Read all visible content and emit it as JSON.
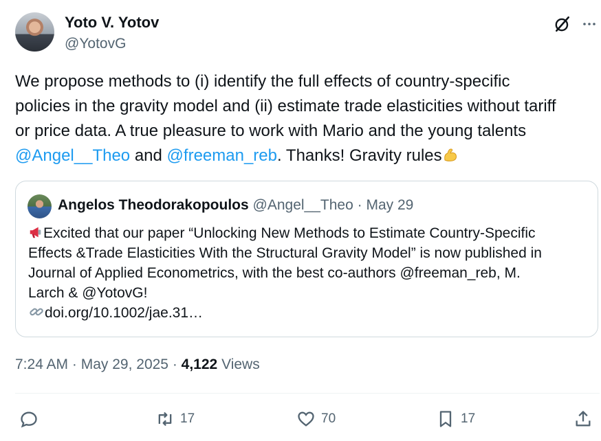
{
  "author": {
    "display_name": "Yoto V. Yotov",
    "handle": "@YotovG"
  },
  "header_icons": [
    "grok-icon",
    "more-icon"
  ],
  "tweet": {
    "line1": "We propose methods to (i) identify the full effects of country-specific",
    "line2": "policies in the gravity model and (ii) estimate trade elasticities without tariff",
    "line3": "or price data. A true pleasure to work with Mario and the young talents",
    "mention1": "@Angel__Theo",
    "and": " and ",
    "mention2": "@freeman_reb",
    "tail": ". Thanks! Gravity rules",
    "emoji": "flexed-biceps-emoji"
  },
  "quote": {
    "name": "Angelos Theodorakopoulos",
    "handle": "@Angel__Theo",
    "separator": " · ",
    "date": "May 29",
    "line1": "Excited that our paper “Unlocking New Methods to Estimate Country-Specific",
    "line2": "Effects &Trade Elasticities With the Structural Gravity Model” is now published in",
    "line3": "Journal of Applied Econometrics, with the best co-authors @freeman_reb, M.",
    "line4": "Larch & @YotovG!",
    "link": "doi.org/10.1002/jae.31…",
    "lead_emoji": "megaphone-emoji",
    "link_emoji": "link-emoji"
  },
  "meta": {
    "time": "7:24 AM",
    "sep1": " · ",
    "date": "May 29, 2025",
    "sep2": " · ",
    "views_count": "4,122",
    "views_label": " Views"
  },
  "actions": {
    "reply_count": "",
    "retweet_count": "17",
    "like_count": "70",
    "bookmark_count": "17"
  },
  "colors": {
    "link": "#1d9bf0",
    "secondary": "#536471",
    "primary": "#0f1419",
    "border": "#cfd9de"
  }
}
